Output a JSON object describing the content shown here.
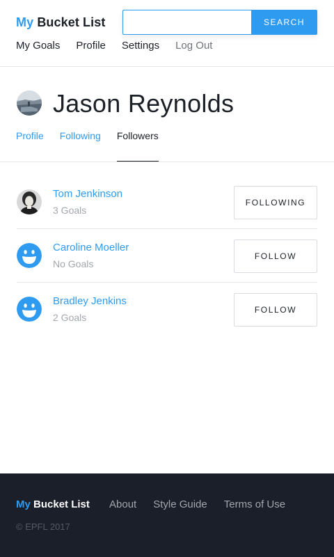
{
  "header": {
    "logo_prefix": "My",
    "logo_main": "Bucket List",
    "search_value": "",
    "search_placeholder": "",
    "search_button": "SEARCH",
    "nav": [
      {
        "label": "My Goals"
      },
      {
        "label": "Profile"
      },
      {
        "label": "Settings"
      },
      {
        "label": "Log Out"
      }
    ]
  },
  "profile": {
    "name": "Jason Reynolds",
    "tabs": [
      {
        "label": "Profile"
      },
      {
        "label": "Following"
      },
      {
        "label": "Followers",
        "active": true
      }
    ]
  },
  "followers": [
    {
      "name": "Tom Jenkinson",
      "goals": "3 Goals",
      "button": "FOLLOWING",
      "avatar": "photo-avatar"
    },
    {
      "name": "Caroline Moeller",
      "goals": "No Goals",
      "button": "FOLLOW",
      "avatar": "smiley-avatar-icon"
    },
    {
      "name": "Bradley Jenkins",
      "goals": "2 Goals",
      "button": "FOLLOW",
      "avatar": "smiley-avatar-icon"
    }
  ],
  "footer": {
    "logo_prefix": "My",
    "logo_main": "Bucket List",
    "links": [
      {
        "label": "About"
      },
      {
        "label": "Style Guide"
      },
      {
        "label": "Terms of Use"
      }
    ],
    "copyright": "© EPFL 2017"
  },
  "colors": {
    "accent": "#2f9bf0",
    "text": "#1b1f26",
    "muted": "#a3a7ad",
    "footer_bg": "#1b1f29"
  }
}
